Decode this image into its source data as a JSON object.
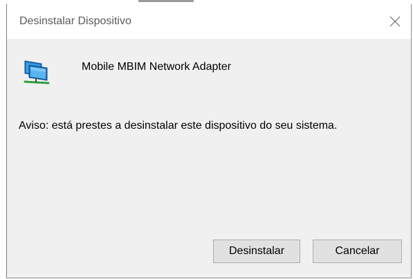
{
  "dialog": {
    "title": "Desinstalar Dispositivo",
    "close_icon": "close-icon"
  },
  "device": {
    "icon": "network-adapter-icon",
    "name": "Mobile MBIM Network Adapter"
  },
  "warning_text": "Aviso: está prestes a desinstalar este dispositivo do seu sistema.",
  "buttons": {
    "uninstall_label": "Desinstalar",
    "cancel_label": "Cancelar"
  },
  "colors": {
    "dialog_background": "#f0f0f0",
    "titlebar_background": "#ffffff",
    "button_background": "#e1e1e1",
    "button_border": "#adadad"
  }
}
